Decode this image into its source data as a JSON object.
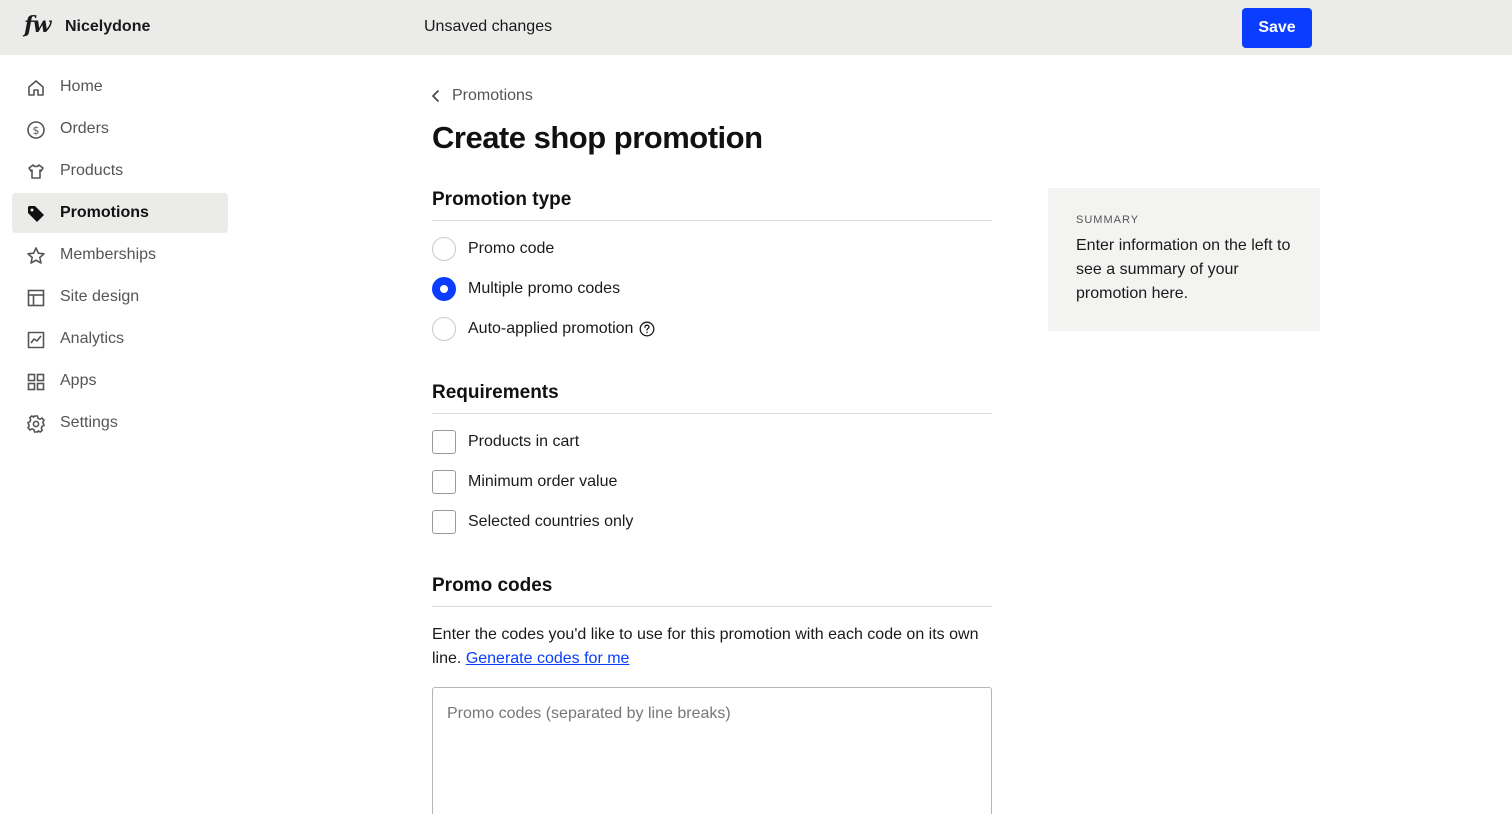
{
  "topbar": {
    "logo": "fw",
    "shop_name": "Nicelydone",
    "status": "Unsaved changes",
    "save_label": "Save"
  },
  "sidebar": {
    "items": [
      {
        "label": "Home",
        "icon": "home-icon"
      },
      {
        "label": "Orders",
        "icon": "dollar-circle-icon"
      },
      {
        "label": "Products",
        "icon": "tshirt-icon"
      },
      {
        "label": "Promotions",
        "icon": "tag-icon",
        "active": true
      },
      {
        "label": "Memberships",
        "icon": "star-icon"
      },
      {
        "label": "Site design",
        "icon": "layout-icon"
      },
      {
        "label": "Analytics",
        "icon": "chart-icon"
      },
      {
        "label": "Apps",
        "icon": "grid-icon"
      },
      {
        "label": "Settings",
        "icon": "gear-icon"
      }
    ]
  },
  "main": {
    "breadcrumb": "Promotions",
    "title": "Create shop promotion",
    "promotion_type": {
      "heading": "Promotion type",
      "options": [
        {
          "label": "Promo code",
          "selected": false
        },
        {
          "label": "Multiple promo codes",
          "selected": true
        },
        {
          "label": "Auto-applied promotion",
          "selected": false,
          "help_icon": "question-circle-icon"
        }
      ]
    },
    "requirements": {
      "heading": "Requirements",
      "options": [
        {
          "label": "Products in cart",
          "checked": false
        },
        {
          "label": "Minimum order value",
          "checked": false
        },
        {
          "label": "Selected countries only",
          "checked": false
        }
      ]
    },
    "promo_codes": {
      "heading": "Promo codes",
      "description": "Enter the codes you'd like to use for this promotion with each code on its own line.",
      "link": "Generate codes for me",
      "placeholder": "Promo codes (separated by line breaks)",
      "value": ""
    }
  },
  "summary": {
    "heading": "SUMMARY",
    "text": "Enter information on the left to see a summary of your promotion here."
  },
  "colors": {
    "accent": "#0a3dff",
    "topbar_bg": "#ebebea",
    "summary_bg": "#f3f3f2"
  }
}
